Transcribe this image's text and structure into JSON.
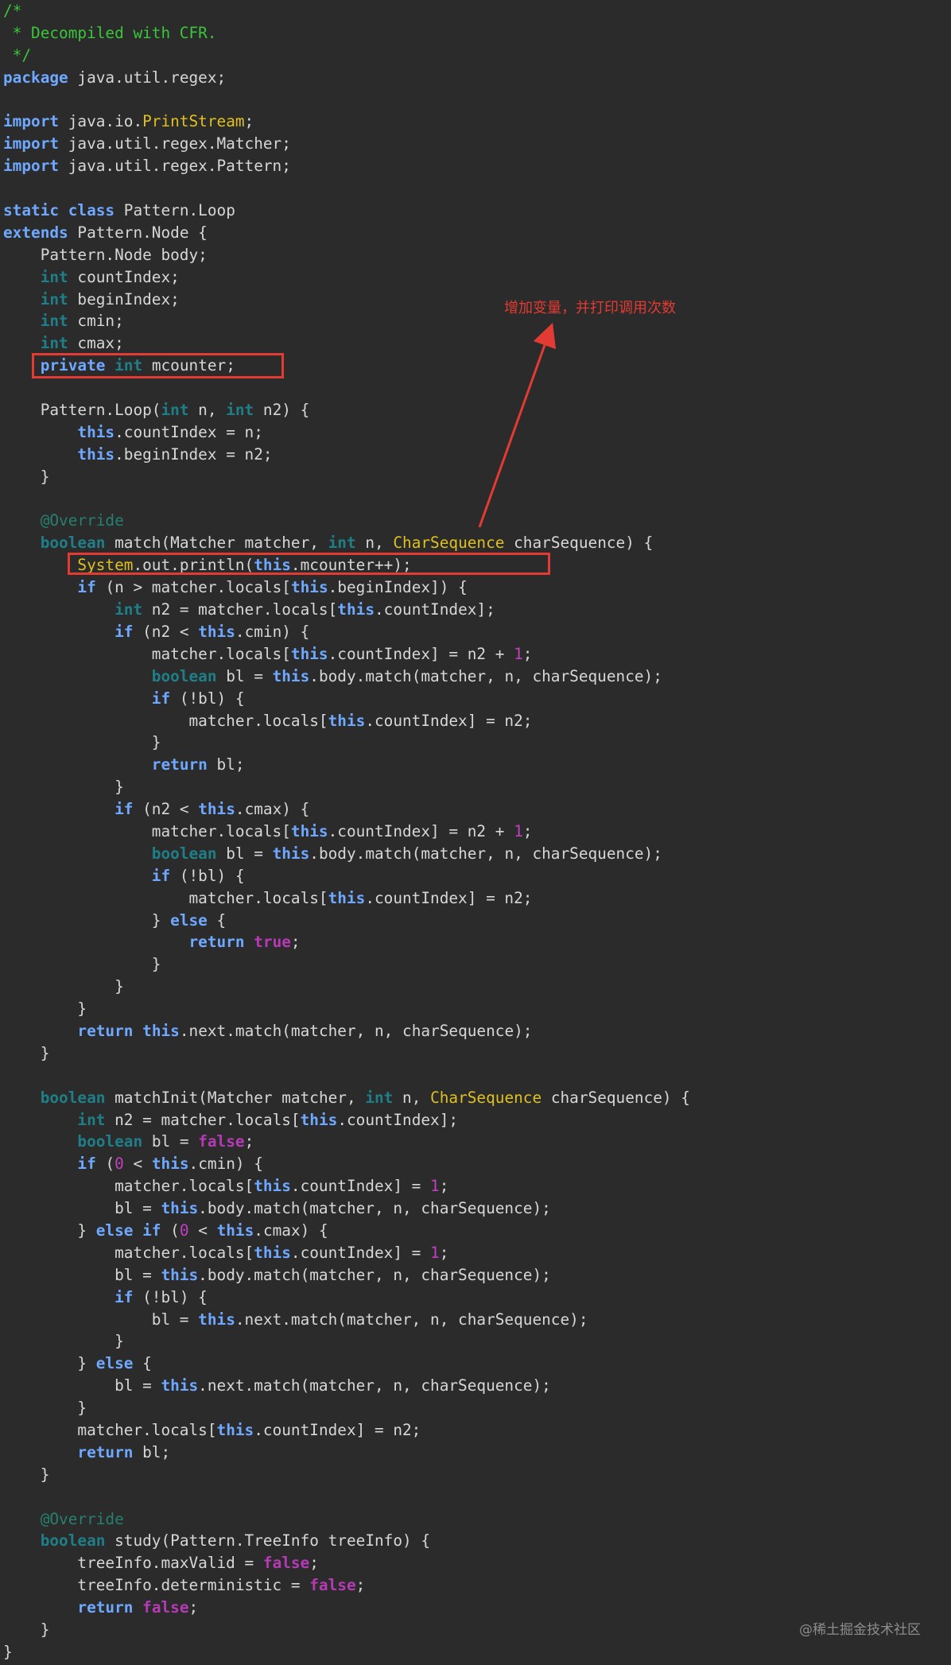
{
  "colors": {
    "background": "#2b2b2b",
    "keyword": "#6fa8ff",
    "primitive_type": "#1f7f88",
    "class_name": "#e0c020",
    "number": "#c040c0",
    "literal": "#b63ab6",
    "annotation": "#27806f",
    "comment": "#3ac63a",
    "highlight": "#e23b33"
  },
  "annotation_note": "增加变量，并打印调用次数",
  "watermark": "@稀土掘金技术社区",
  "code": [
    [
      [
        "cm",
        "/*"
      ]
    ],
    [
      [
        "cm",
        " * Decompiled with CFR."
      ]
    ],
    [
      [
        "cm",
        " */"
      ]
    ],
    [
      [
        "kw",
        "package"
      ],
      [
        "p",
        " java.util.regex;"
      ]
    ],
    [],
    [
      [
        "kw",
        "import"
      ],
      [
        "p",
        " java.io."
      ],
      [
        "cls",
        "PrintStream"
      ],
      [
        "p",
        ";"
      ]
    ],
    [
      [
        "kw",
        "import"
      ],
      [
        "p",
        " java.util.regex.Matcher;"
      ]
    ],
    [
      [
        "kw",
        "import"
      ],
      [
        "p",
        " java.util.regex.Pattern;"
      ]
    ],
    [],
    [
      [
        "kw",
        "static"
      ],
      [
        "p",
        " "
      ],
      [
        "kw",
        "class"
      ],
      [
        "p",
        " Pattern.Loop"
      ]
    ],
    [
      [
        "kw",
        "extends"
      ],
      [
        "p",
        " Pattern.Node {"
      ]
    ],
    [
      [
        "p",
        "    Pattern.Node body;"
      ]
    ],
    [
      [
        "p",
        "    "
      ],
      [
        "ty",
        "int"
      ],
      [
        "p",
        " countIndex;"
      ]
    ],
    [
      [
        "p",
        "    "
      ],
      [
        "ty",
        "int"
      ],
      [
        "p",
        " beginIndex;"
      ]
    ],
    [
      [
        "p",
        "    "
      ],
      [
        "ty",
        "int"
      ],
      [
        "p",
        " cmin;"
      ]
    ],
    [
      [
        "p",
        "    "
      ],
      [
        "ty",
        "int"
      ],
      [
        "p",
        " cmax;"
      ]
    ],
    [
      [
        "p",
        "    "
      ],
      [
        "kw",
        "private"
      ],
      [
        "p",
        " "
      ],
      [
        "ty",
        "int"
      ],
      [
        "p",
        " mcounter;"
      ]
    ],
    [],
    [
      [
        "p",
        "    Pattern.Loop("
      ],
      [
        "ty",
        "int"
      ],
      [
        "p",
        " n, "
      ],
      [
        "ty",
        "int"
      ],
      [
        "p",
        " n2) {"
      ]
    ],
    [
      [
        "p",
        "        "
      ],
      [
        "kw",
        "this"
      ],
      [
        "p",
        ".countIndex = n;"
      ]
    ],
    [
      [
        "p",
        "        "
      ],
      [
        "kw",
        "this"
      ],
      [
        "p",
        ".beginIndex = n2;"
      ]
    ],
    [
      [
        "p",
        "    }"
      ]
    ],
    [],
    [
      [
        "p",
        "    "
      ],
      [
        "ann",
        "@Override"
      ]
    ],
    [
      [
        "p",
        "    "
      ],
      [
        "ty",
        "boolean"
      ],
      [
        "p",
        " match(Matcher matcher, "
      ],
      [
        "ty",
        "int"
      ],
      [
        "p",
        " n, "
      ],
      [
        "cls",
        "CharSequence"
      ],
      [
        "p",
        " charSequence) {"
      ]
    ],
    [
      [
        "p",
        "        "
      ],
      [
        "cls",
        "System"
      ],
      [
        "p",
        ".out.println("
      ],
      [
        "kw",
        "this"
      ],
      [
        "p",
        ".mcounter++);"
      ]
    ],
    [
      [
        "p",
        "        "
      ],
      [
        "kw",
        "if"
      ],
      [
        "p",
        " (n > matcher.locals["
      ],
      [
        "kw",
        "this"
      ],
      [
        "p",
        ".beginIndex]) {"
      ]
    ],
    [
      [
        "p",
        "            "
      ],
      [
        "ty",
        "int"
      ],
      [
        "p",
        " n2 = matcher.locals["
      ],
      [
        "kw",
        "this"
      ],
      [
        "p",
        ".countIndex];"
      ]
    ],
    [
      [
        "p",
        "            "
      ],
      [
        "kw",
        "if"
      ],
      [
        "p",
        " (n2 < "
      ],
      [
        "kw",
        "this"
      ],
      [
        "p",
        ".cmin) {"
      ]
    ],
    [
      [
        "p",
        "                matcher.locals["
      ],
      [
        "kw",
        "this"
      ],
      [
        "p",
        ".countIndex] = n2 + "
      ],
      [
        "num",
        "1"
      ],
      [
        "p",
        ";"
      ]
    ],
    [
      [
        "p",
        "                "
      ],
      [
        "ty",
        "boolean"
      ],
      [
        "p",
        " bl = "
      ],
      [
        "kw",
        "this"
      ],
      [
        "p",
        ".body.match(matcher, n, charSequence);"
      ]
    ],
    [
      [
        "p",
        "                "
      ],
      [
        "kw",
        "if"
      ],
      [
        "p",
        " (!bl) {"
      ]
    ],
    [
      [
        "p",
        "                    matcher.locals["
      ],
      [
        "kw",
        "this"
      ],
      [
        "p",
        ".countIndex] = n2;"
      ]
    ],
    [
      [
        "p",
        "                }"
      ]
    ],
    [
      [
        "p",
        "                "
      ],
      [
        "kw",
        "return"
      ],
      [
        "p",
        " bl;"
      ]
    ],
    [
      [
        "p",
        "            }"
      ]
    ],
    [
      [
        "p",
        "            "
      ],
      [
        "kw",
        "if"
      ],
      [
        "p",
        " (n2 < "
      ],
      [
        "kw",
        "this"
      ],
      [
        "p",
        ".cmax) {"
      ]
    ],
    [
      [
        "p",
        "                matcher.locals["
      ],
      [
        "kw",
        "this"
      ],
      [
        "p",
        ".countIndex] = n2 + "
      ],
      [
        "num",
        "1"
      ],
      [
        "p",
        ";"
      ]
    ],
    [
      [
        "p",
        "                "
      ],
      [
        "ty",
        "boolean"
      ],
      [
        "p",
        " bl = "
      ],
      [
        "kw",
        "this"
      ],
      [
        "p",
        ".body.match(matcher, n, charSequence);"
      ]
    ],
    [
      [
        "p",
        "                "
      ],
      [
        "kw",
        "if"
      ],
      [
        "p",
        " (!bl) {"
      ]
    ],
    [
      [
        "p",
        "                    matcher.locals["
      ],
      [
        "kw",
        "this"
      ],
      [
        "p",
        ".countIndex] = n2;"
      ]
    ],
    [
      [
        "p",
        "                } "
      ],
      [
        "kw",
        "else"
      ],
      [
        "p",
        " {"
      ]
    ],
    [
      [
        "p",
        "                    "
      ],
      [
        "kw",
        "return"
      ],
      [
        "p",
        " "
      ],
      [
        "lit",
        "true"
      ],
      [
        "p",
        ";"
      ]
    ],
    [
      [
        "p",
        "                }"
      ]
    ],
    [
      [
        "p",
        "            }"
      ]
    ],
    [
      [
        "p",
        "        }"
      ]
    ],
    [
      [
        "p",
        "        "
      ],
      [
        "kw",
        "return"
      ],
      [
        "p",
        " "
      ],
      [
        "kw",
        "this"
      ],
      [
        "p",
        ".next.match(matcher, n, charSequence);"
      ]
    ],
    [
      [
        "p",
        "    }"
      ]
    ],
    [],
    [
      [
        "p",
        "    "
      ],
      [
        "ty",
        "boolean"
      ],
      [
        "p",
        " matchInit(Matcher matcher, "
      ],
      [
        "ty",
        "int"
      ],
      [
        "p",
        " n, "
      ],
      [
        "cls",
        "CharSequence"
      ],
      [
        "p",
        " charSequence) {"
      ]
    ],
    [
      [
        "p",
        "        "
      ],
      [
        "ty",
        "int"
      ],
      [
        "p",
        " n2 = matcher.locals["
      ],
      [
        "kw",
        "this"
      ],
      [
        "p",
        ".countIndex];"
      ]
    ],
    [
      [
        "p",
        "        "
      ],
      [
        "ty",
        "boolean"
      ],
      [
        "p",
        " bl = "
      ],
      [
        "lit",
        "false"
      ],
      [
        "p",
        ";"
      ]
    ],
    [
      [
        "p",
        "        "
      ],
      [
        "kw",
        "if"
      ],
      [
        "p",
        " ("
      ],
      [
        "num",
        "0"
      ],
      [
        "p",
        " < "
      ],
      [
        "kw",
        "this"
      ],
      [
        "p",
        ".cmin) {"
      ]
    ],
    [
      [
        "p",
        "            matcher.locals["
      ],
      [
        "kw",
        "this"
      ],
      [
        "p",
        ".countIndex] = "
      ],
      [
        "num",
        "1"
      ],
      [
        "p",
        ";"
      ]
    ],
    [
      [
        "p",
        "            bl = "
      ],
      [
        "kw",
        "this"
      ],
      [
        "p",
        ".body.match(matcher, n, charSequence);"
      ]
    ],
    [
      [
        "p",
        "        } "
      ],
      [
        "kw",
        "else if"
      ],
      [
        "p",
        " ("
      ],
      [
        "num",
        "0"
      ],
      [
        "p",
        " < "
      ],
      [
        "kw",
        "this"
      ],
      [
        "p",
        ".cmax) {"
      ]
    ],
    [
      [
        "p",
        "            matcher.locals["
      ],
      [
        "kw",
        "this"
      ],
      [
        "p",
        ".countIndex] = "
      ],
      [
        "num",
        "1"
      ],
      [
        "p",
        ";"
      ]
    ],
    [
      [
        "p",
        "            bl = "
      ],
      [
        "kw",
        "this"
      ],
      [
        "p",
        ".body.match(matcher, n, charSequence);"
      ]
    ],
    [
      [
        "p",
        "            "
      ],
      [
        "kw",
        "if"
      ],
      [
        "p",
        " (!bl) {"
      ]
    ],
    [
      [
        "p",
        "                bl = "
      ],
      [
        "kw",
        "this"
      ],
      [
        "p",
        ".next.match(matcher, n, charSequence);"
      ]
    ],
    [
      [
        "p",
        "            }"
      ]
    ],
    [
      [
        "p",
        "        } "
      ],
      [
        "kw",
        "else"
      ],
      [
        "p",
        " {"
      ]
    ],
    [
      [
        "p",
        "            bl = "
      ],
      [
        "kw",
        "this"
      ],
      [
        "p",
        ".next.match(matcher, n, charSequence);"
      ]
    ],
    [
      [
        "p",
        "        }"
      ]
    ],
    [
      [
        "p",
        "        matcher.locals["
      ],
      [
        "kw",
        "this"
      ],
      [
        "p",
        ".countIndex] = n2;"
      ]
    ],
    [
      [
        "p",
        "        "
      ],
      [
        "kw",
        "return"
      ],
      [
        "p",
        " bl;"
      ]
    ],
    [
      [
        "p",
        "    }"
      ]
    ],
    [],
    [
      [
        "p",
        "    "
      ],
      [
        "ann",
        "@Override"
      ]
    ],
    [
      [
        "p",
        "    "
      ],
      [
        "ty",
        "boolean"
      ],
      [
        "p",
        " study(Pattern.TreeInfo treeInfo) {"
      ]
    ],
    [
      [
        "p",
        "        treeInfo.maxValid = "
      ],
      [
        "lit",
        "false"
      ],
      [
        "p",
        ";"
      ]
    ],
    [
      [
        "p",
        "        treeInfo.deterministic = "
      ],
      [
        "lit",
        "false"
      ],
      [
        "p",
        ";"
      ]
    ],
    [
      [
        "p",
        "        "
      ],
      [
        "kw",
        "return"
      ],
      [
        "p",
        " "
      ],
      [
        "lit",
        "false"
      ],
      [
        "p",
        ";"
      ]
    ],
    [
      [
        "p",
        "    }"
      ]
    ],
    [
      [
        "p",
        "}"
      ]
    ]
  ]
}
